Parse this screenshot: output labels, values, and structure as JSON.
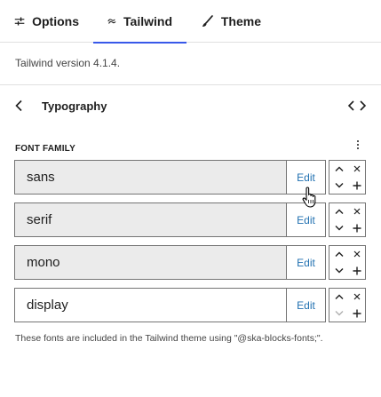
{
  "tabs": [
    {
      "label": "Options",
      "icon": "sliders-icon",
      "active": false
    },
    {
      "label": "Tailwind",
      "icon": "tailwind-logo-icon",
      "active": true
    },
    {
      "label": "Theme",
      "icon": "brush-icon",
      "active": false
    }
  ],
  "version_text": "Tailwind version 4.1.4.",
  "nav": {
    "title": "Typography",
    "back_icon": "chevron-left-icon",
    "code_icon": "code-icon"
  },
  "section": {
    "title": "FONT FAMILY",
    "menu_icon": "more-vertical-icon"
  },
  "fonts": [
    {
      "name": "sans",
      "edit_label": "Edit",
      "filled": true
    },
    {
      "name": "serif",
      "edit_label": "Edit",
      "filled": true
    },
    {
      "name": "mono",
      "edit_label": "Edit",
      "filled": true
    },
    {
      "name": "display",
      "edit_label": "Edit",
      "filled": false
    }
  ],
  "footnote": "These fonts are included in the Tailwind theme using \"@ska-blocks-fonts;\".",
  "colors": {
    "accent": "#3858e9",
    "link": "#2271b1",
    "border": "#757575",
    "field_bg": "#ebebeb"
  }
}
